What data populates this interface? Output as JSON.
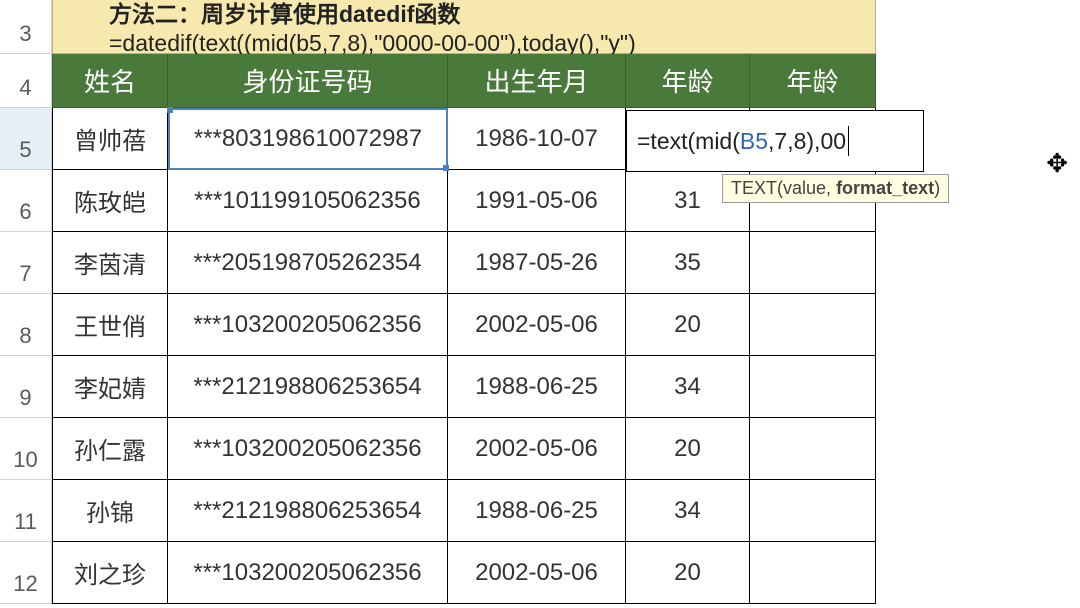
{
  "note": {
    "line1": "方法二：周岁计算使用datedif函数",
    "line2": "=datedif(text((mid(b5,7,8),\"0000-00-00\"),today(),\"y\")"
  },
  "columns": {
    "name": "姓名",
    "id": "身份证号码",
    "dob": "出生年月",
    "age1": "年龄",
    "age2": "年龄"
  },
  "rows": [
    {
      "n": "5",
      "name": "曾帅蓓",
      "id": "***803198610072987",
      "dob": "1986-10-07",
      "age": ""
    },
    {
      "n": "6",
      "name": "陈玫皑",
      "id": "***101199105062356",
      "dob": "1991-05-06",
      "age": "31"
    },
    {
      "n": "7",
      "name": "李茵清",
      "id": "***205198705262354",
      "dob": "1987-05-26",
      "age": "35"
    },
    {
      "n": "8",
      "name": "王世俏",
      "id": "***103200205062356",
      "dob": "2002-05-06",
      "age": "20"
    },
    {
      "n": "9",
      "name": "李妃婧",
      "id": "***212198806253654",
      "dob": "1988-06-25",
      "age": "34"
    },
    {
      "n": "10",
      "name": "孙仁露",
      "id": "***103200205062356",
      "dob": "2002-05-06",
      "age": "20"
    },
    {
      "n": "11",
      "name": "孙锦",
      "id": "***212198806253654",
      "dob": "1988-06-25",
      "age": "34"
    },
    {
      "n": "12",
      "name": "刘之珍",
      "id": "***103200205062356",
      "dob": "2002-05-06",
      "age": "20"
    }
  ],
  "row_headers": {
    "r3": "3",
    "r4": "4"
  },
  "formula": {
    "prefix": "=text(mid(",
    "ref": "B5",
    "suffix": ",7,8),00"
  },
  "tooltip": {
    "fn": "TEXT",
    "arg1": "value",
    "arg2": "format_text"
  },
  "hover_icon": "✥"
}
